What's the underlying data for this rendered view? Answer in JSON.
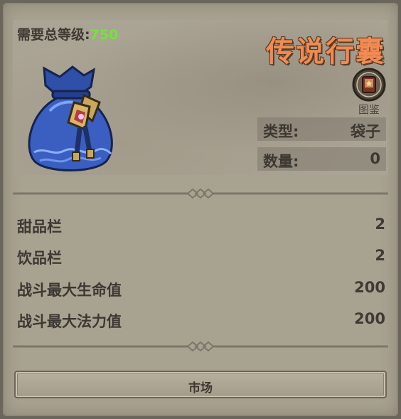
{
  "header": {
    "requirement_label": "需要总等级:",
    "requirement_value": "750",
    "item_title": "传说行囊",
    "codex_label": "图鉴",
    "icons": {
      "item": "blue-pouch-icon",
      "codex": "codex-book-icon"
    }
  },
  "info": {
    "type_label": "类型:",
    "type_value": "袋子",
    "quantity_label": "数量:",
    "quantity_value": "0"
  },
  "attributes": [
    {
      "label": "甜品栏",
      "value": "2"
    },
    {
      "label": "饮品栏",
      "value": "2"
    },
    {
      "label": "战斗最大生命值",
      "value": "200"
    },
    {
      "label": "战斗最大法力值",
      "value": "200"
    }
  ],
  "actions": {
    "market_label": "市场"
  },
  "colors": {
    "title": "#ef8b53",
    "level": "#74e33a",
    "panel": "#a8a291"
  }
}
